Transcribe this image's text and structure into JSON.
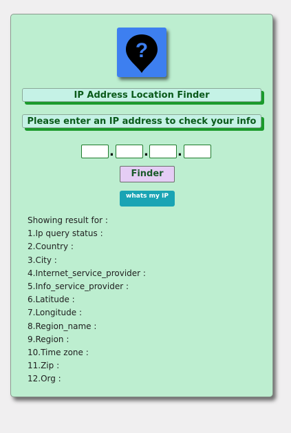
{
  "app": {
    "title": "IP Address Location Finder",
    "subtitle": "Please enter an IP address to check your info"
  },
  "logo": {
    "icon": "location-question-icon",
    "color": "#3d7ff0"
  },
  "ip_inputs": [
    {
      "value": "",
      "placeholder": ""
    },
    {
      "value": "",
      "placeholder": ""
    },
    {
      "value": "",
      "placeholder": ""
    },
    {
      "value": "",
      "placeholder": ""
    }
  ],
  "separator": ".",
  "buttons": {
    "finder_label": "Finder",
    "myip_label": "whats my IP"
  },
  "results": {
    "header": "Showing result for :",
    "fields": [
      "1.Ip query status :",
      "2.Country :",
      "3.City :",
      "4.Internet_service_provider :",
      "5.Info_service_provider :",
      "6.Latitude :",
      "7.Longitude :",
      "8.Region_name :",
      "9.Region :",
      "10.Time zone :",
      "11.Zip :",
      "12.Org :"
    ]
  },
  "colors": {
    "card_bg": "#bdeed0",
    "banner_text": "#0a5a1a",
    "finder_bg": "#e5cdf5",
    "myip_bg": "#1aa4b4"
  }
}
